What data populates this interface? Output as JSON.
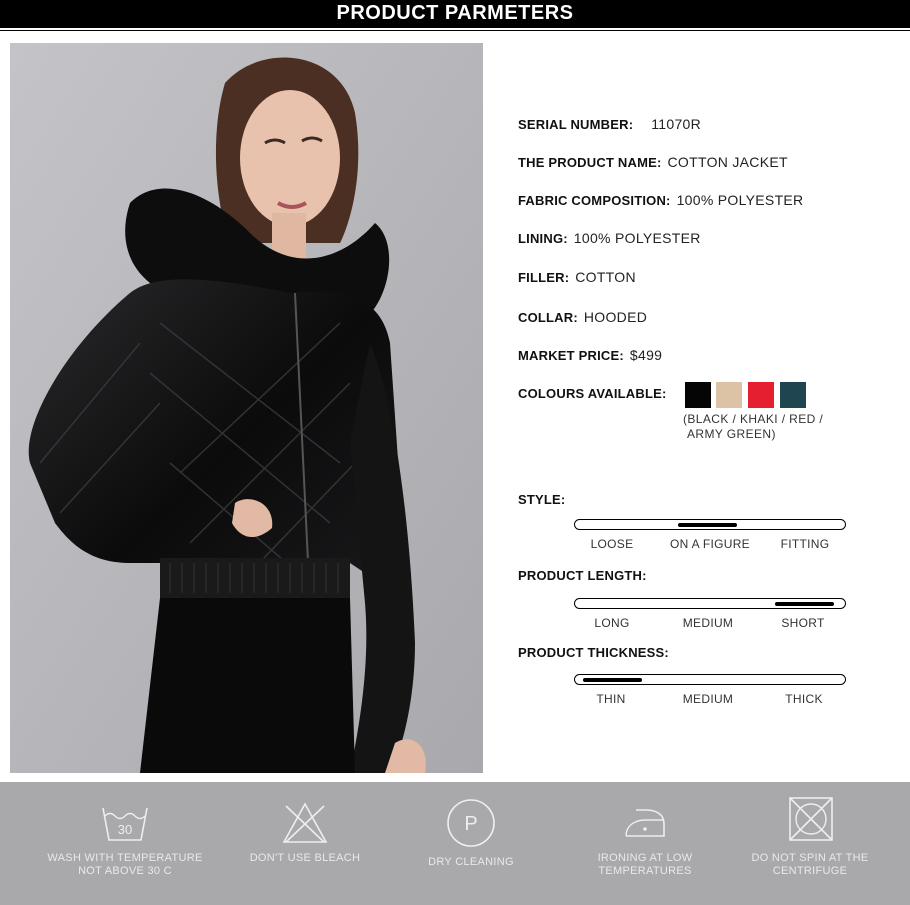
{
  "header": {
    "title": "PRODUCT PARMETERS"
  },
  "photo": {
    "description_icon": "model-photo"
  },
  "specs": {
    "serial": {
      "key": "SERIAL NUMBER:",
      "value": "11070R"
    },
    "name": {
      "key": "THE PRODUCT NAME:",
      "value": "COTTON JACKET"
    },
    "fabric": {
      "key": "FABRIC COMPOSITION:",
      "value": "100% POLYESTER"
    },
    "lining": {
      "key": "LINING:",
      "value": "100% POLYESTER"
    },
    "filler": {
      "key": "FILLER:",
      "value": "COTTON"
    },
    "collar": {
      "key": "COLLAR:",
      "value": "HOODED"
    },
    "price": {
      "key": "MARKET PRICE:",
      "value": "$499"
    },
    "colours": {
      "key": "COLOURS AVAILABLE:",
      "swatches": [
        "#050505",
        "#dcc3a6",
        "#e51f30",
        "#1f4650"
      ],
      "note_line1": "(BLACK / KHAKI / RED /",
      "note_line2": "ARMY GREEN)"
    }
  },
  "scales": {
    "style": {
      "label": "STYLE:",
      "ticks": [
        "LOOSE",
        "ON A FIGURE",
        "FITTING"
      ],
      "fill_from": 0.38,
      "fill_to": 0.6
    },
    "length": {
      "label": "PRODUCT LENGTH:",
      "ticks": [
        "LONG",
        "MEDIUM",
        "SHORT"
      ],
      "fill_from": 0.74,
      "fill_to": 0.96
    },
    "thickness": {
      "label": "PRODUCT THICKNESS:",
      "ticks": [
        "THIN",
        "MEDIUM",
        "THICK"
      ],
      "fill_from": 0.03,
      "fill_to": 0.25
    }
  },
  "care": [
    {
      "icon": "wash-30-icon",
      "line1": "WASH WITH TEMPERATURE",
      "line2": "NOT ABOVE 30 C",
      "badge": "30"
    },
    {
      "icon": "no-bleach-icon",
      "line1": "DON'T USE BLEACH",
      "line2": ""
    },
    {
      "icon": "dry-clean-icon",
      "line1": "DRY CLEANING",
      "line2": "",
      "badge": "P"
    },
    {
      "icon": "iron-low-icon",
      "line1": "IRONING AT LOW",
      "line2": "TEMPERATURES"
    },
    {
      "icon": "no-spin-icon",
      "line1": "DO NOT SPIN AT THE",
      "line2": "CENTRIFUGE"
    }
  ]
}
